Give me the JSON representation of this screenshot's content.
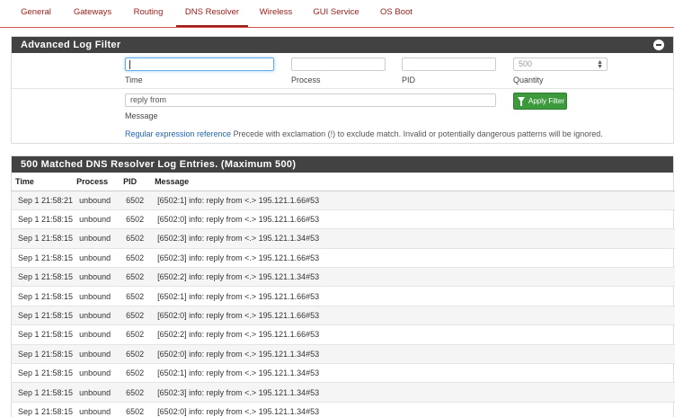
{
  "tabs": [
    {
      "label": "General"
    },
    {
      "label": "Gateways"
    },
    {
      "label": "Routing"
    },
    {
      "label": "DNS Resolver",
      "active": true
    },
    {
      "label": "Wireless"
    },
    {
      "label": "GUI Service"
    },
    {
      "label": "OS Boot"
    }
  ],
  "filter": {
    "heading": "Advanced Log Filter",
    "time_label": "Time",
    "time_value": "",
    "process_label": "Process",
    "process_value": "",
    "pid_label": "PID",
    "pid_value": "",
    "quantity_label": "Quantity",
    "quantity_placeholder": "500",
    "message_label": "Message",
    "message_value": "reply from",
    "apply_label": "Apply Filter",
    "help_link": "Regular expression reference",
    "help_text": " Precede with exclamation (!) to exclude match. Invalid or potentially dangerous patterns will be ignored."
  },
  "log": {
    "heading": "500 Matched DNS Resolver Log Entries. (Maximum 500)",
    "columns": [
      "Time",
      "Process",
      "PID",
      "Message"
    ],
    "rows": [
      [
        "Sep 1 21:58:21",
        "unbound",
        "6502",
        "[6502:1] info: reply from <.> 195.121.1.66#53"
      ],
      [
        "Sep 1 21:58:15",
        "unbound",
        "6502",
        "[6502:0] info: reply from <.> 195.121.1.66#53"
      ],
      [
        "Sep 1 21:58:15",
        "unbound",
        "6502",
        "[6502:3] info: reply from <.> 195.121.1.34#53"
      ],
      [
        "Sep 1 21:58:15",
        "unbound",
        "6502",
        "[6502:3] info: reply from <.> 195.121.1.66#53"
      ],
      [
        "Sep 1 21:58:15",
        "unbound",
        "6502",
        "[6502:2] info: reply from <.> 195.121.1.34#53"
      ],
      [
        "Sep 1 21:58:15",
        "unbound",
        "6502",
        "[6502:1] info: reply from <.> 195.121.1.66#53"
      ],
      [
        "Sep 1 21:58:15",
        "unbound",
        "6502",
        "[6502:0] info: reply from <.> 195.121.1.66#53"
      ],
      [
        "Sep 1 21:58:15",
        "unbound",
        "6502",
        "[6502:2] info: reply from <.> 195.121.1.66#53"
      ],
      [
        "Sep 1 21:58:15",
        "unbound",
        "6502",
        "[6502:0] info: reply from <.> 195.121.1.34#53"
      ],
      [
        "Sep 1 21:58:15",
        "unbound",
        "6502",
        "[6502:1] info: reply from <.> 195.121.1.34#53"
      ],
      [
        "Sep 1 21:58:15",
        "unbound",
        "6502",
        "[6502:3] info: reply from <.> 195.121.1.34#53"
      ],
      [
        "Sep 1 21:58:15",
        "unbound",
        "6502",
        "[6502:0] info: reply from <.> 195.121.1.34#53"
      ]
    ]
  }
}
